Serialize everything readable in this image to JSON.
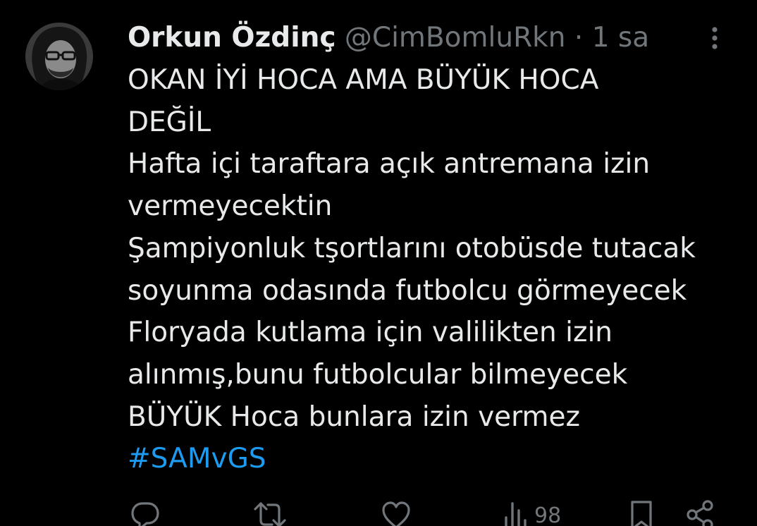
{
  "tweet": {
    "author_name": "Orkun Özdinç",
    "handle": "@CimBomluRkn",
    "separator": "·",
    "time": "1 sa",
    "lines": [
      "OKAN İYİ HOCA AMA BÜYÜK HOCA",
      "DEĞİL",
      "Hafta içi taraftara açık antremana izin",
      "vermeyecektin",
      "Şampiyonluk tşortlarını otobüsde tutacak",
      "soyunma odasında futbolcu görmeyecek",
      "Floryada kutlama için valilikten izin",
      "alınmış,bunu futbolcular bilmeyecek",
      "BÜYÜK Hoca bunlara izin vermez"
    ],
    "hashtag": "#SAMvGS"
  },
  "actions": {
    "views": "98",
    "icons": [
      "reply-icon",
      "retweet-icon",
      "like-icon",
      "views-icon",
      "bookmark-icon",
      "share-icon"
    ]
  },
  "colors": {
    "background": "#000000",
    "text": "#e7e9ea",
    "muted": "#71767b",
    "link": "#1d9bf0"
  }
}
